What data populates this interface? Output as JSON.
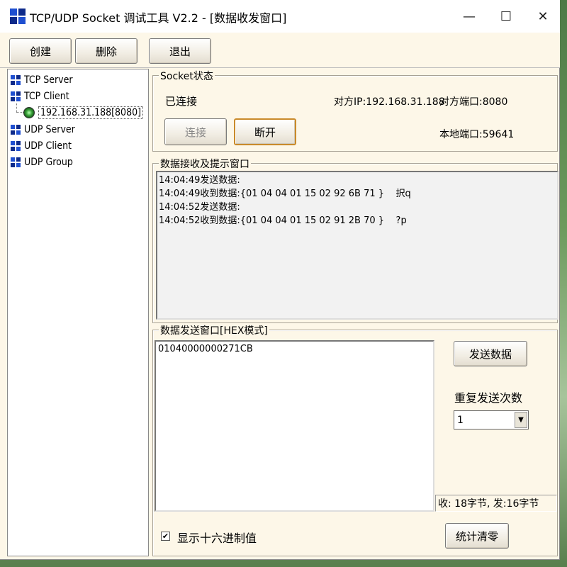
{
  "window": {
    "title": "TCP/UDP Socket 调试工具 V2.2 - [数据收发窗口]",
    "minimize_glyph": "—",
    "maximize_glyph": "☐",
    "close_glyph": "✕"
  },
  "colors": {
    "icon_blue": "#1f4fd0",
    "icon_dark": "#0d2a8a",
    "window_bg": "#fdf7e8"
  },
  "toolbar": {
    "create_label": "创建",
    "delete_label": "删除",
    "exit_label": "退出"
  },
  "tree": {
    "items": [
      {
        "label": "TCP Server",
        "icon": "grid-icon"
      },
      {
        "label": "TCP Client",
        "icon": "grid-icon"
      },
      {
        "label": "192.168.31.188[8080]",
        "icon": "connection-node-icon"
      },
      {
        "label": "UDP Server",
        "icon": "grid-icon"
      },
      {
        "label": "UDP Client",
        "icon": "grid-icon"
      },
      {
        "label": "UDP Group",
        "icon": "grid-icon"
      }
    ]
  },
  "socket": {
    "group_label": "Socket状态",
    "status": "已连接",
    "remote_ip": "对方IP:192.168.31.188",
    "remote_port": "对方端口:8080",
    "local_port": "本地端口:59641",
    "connect_label": "连接",
    "disconnect_label": "断开"
  },
  "receive": {
    "group_label": "数据接收及提示窗口",
    "lines": [
      "14:04:49发送数据:",
      "14:04:49收到数据:{01 04 04 01 15 02 92 6B 71 }    択q",
      "14:04:52发送数据:",
      "14:04:52收到数据:{01 04 04 01 15 02 91 2B 70 }    ?p"
    ]
  },
  "send": {
    "group_label": "数据发送窗口[HEX模式]",
    "content": "01040000000271CB",
    "send_label": "发送数据",
    "repeat_label": "重复发送次数",
    "repeat_value": "1",
    "stats": "收: 18字节, 发:16字节",
    "hex_checkbox_label": "显示十六进制值",
    "hex_checked": true,
    "clear_label": "统计清零"
  }
}
